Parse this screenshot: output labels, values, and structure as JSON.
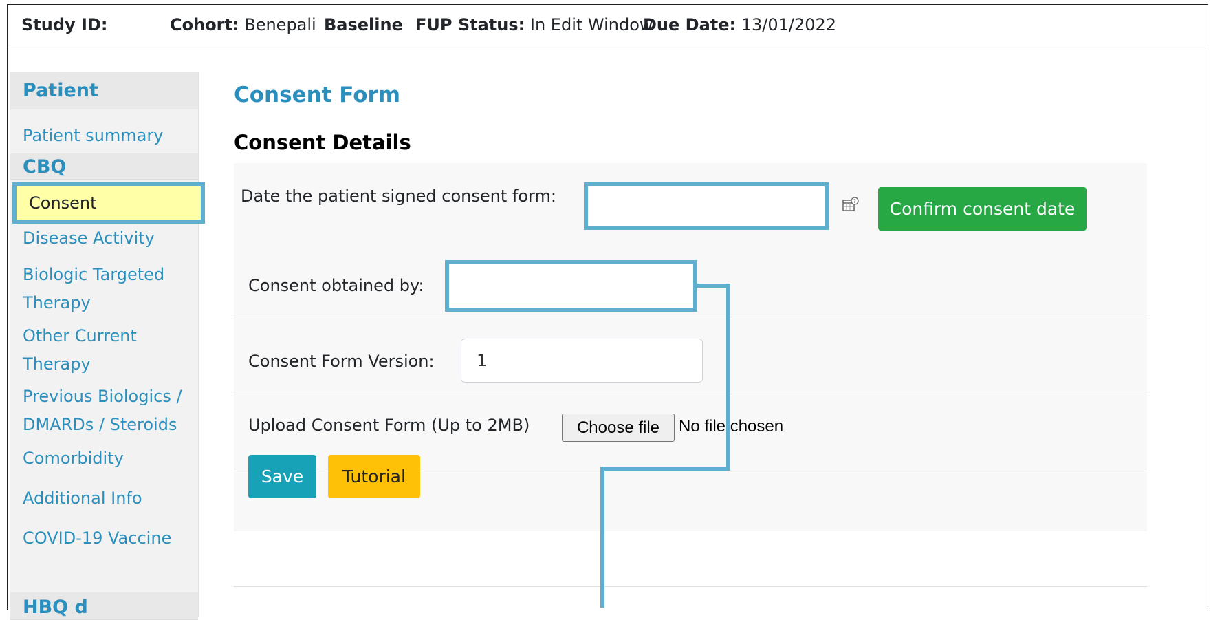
{
  "header": {
    "study_id_label": "Study ID:",
    "cohort_label": "Cohort:",
    "cohort_value": "Benepali",
    "baseline": "Baseline",
    "fup_label": "FUP Status:",
    "fup_value": "In Edit Window",
    "due_label": "Due Date:",
    "due_value": "13/01/2022"
  },
  "sidebar": {
    "sections": [
      "Patient",
      "CBQ",
      "HBQ d"
    ],
    "patient_summary": "Patient summary",
    "consent": "Consent",
    "items": [
      "Disease Activity",
      "Biologic Targeted",
      "Therapy",
      "Other Current",
      "Therapy",
      "Previous Biologics /",
      "DMARDs / Steroids",
      "Comorbidity",
      "Additional Info",
      "COVID-19 Vaccine"
    ]
  },
  "main": {
    "title": "Consent Form",
    "subtitle": "Consent Details",
    "date_label": "Date the patient signed consent form:",
    "date_value": "",
    "confirm_button": "Confirm consent date",
    "obtained_label": "Consent obtained by:",
    "obtained_value": "",
    "version_label": "Consent Form Version:",
    "version_value": "1",
    "upload_label": "Upload Consent Form (Up to 2MB)",
    "choose_file": "Choose file",
    "no_file": "No file chosen",
    "save_button": "Save",
    "tutorial_button": "Tutorial"
  },
  "icons": {
    "calendar": "calendar-help-icon"
  },
  "colors": {
    "accent_blue": "#2a8fbd",
    "highlight": "#5fb0cf",
    "consent_bg": "#ffffa8",
    "green": "#28a745",
    "teal": "#17a2b8",
    "yellow": "#ffc107"
  }
}
